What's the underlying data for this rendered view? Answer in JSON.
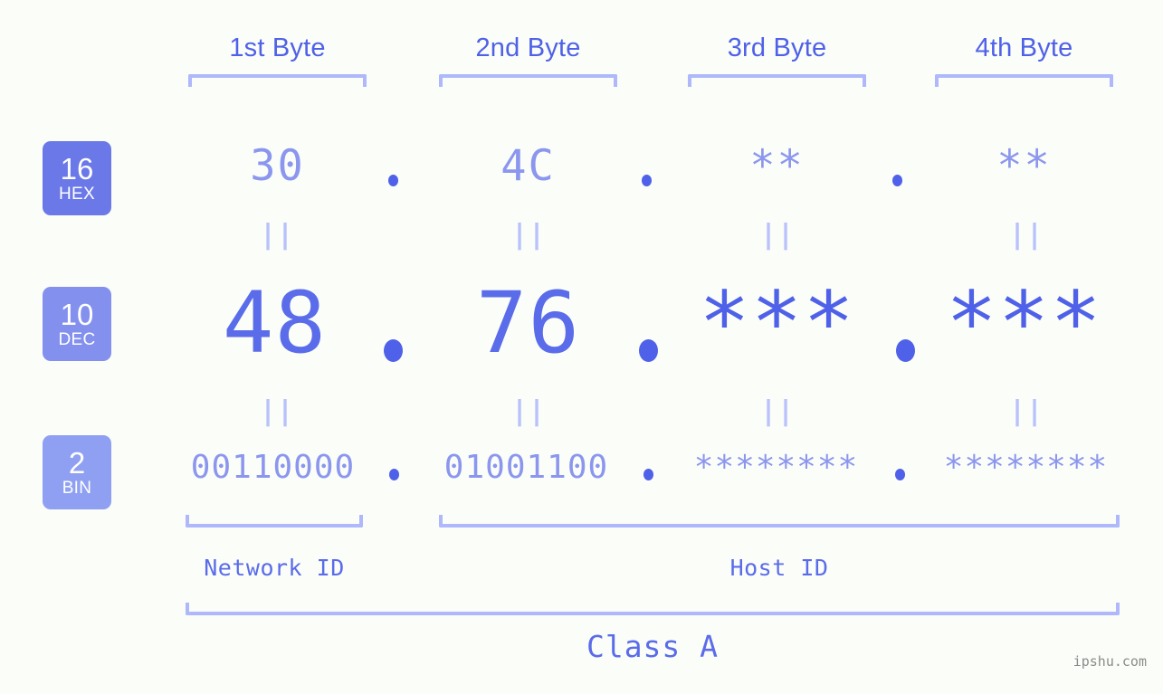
{
  "page": {
    "background_color": "#fbfdf8",
    "accent_color": "#4f61e8",
    "accent_light_color": "#8b96ee",
    "bracket_color": "#aeb8fb"
  },
  "headers": [
    {
      "label": "1st Byte"
    },
    {
      "label": "2nd Byte"
    },
    {
      "label": "3rd Byte"
    },
    {
      "label": "4th Byte"
    }
  ],
  "bases": [
    {
      "number": "16",
      "name": "HEX",
      "color": "#6b78e8"
    },
    {
      "number": "10",
      "name": "DEC",
      "color": "#8490ee"
    },
    {
      "number": "2",
      "name": "BIN",
      "color": "#8fa0f2"
    }
  ],
  "rows": {
    "hex": {
      "base": "16",
      "base_name": "HEX",
      "values": [
        "30",
        "4C",
        "**",
        "**"
      ],
      "separator": "."
    },
    "dec": {
      "base": "10",
      "base_name": "DEC",
      "values": [
        "48",
        "76",
        "***",
        "***"
      ],
      "separator": "."
    },
    "bin": {
      "base": "2",
      "base_name": "BIN",
      "values": [
        "00110000",
        "01001100",
        "********",
        "********"
      ],
      "separator": "."
    }
  },
  "equals": {
    "glyph": "||"
  },
  "segments": {
    "network_id_label": "Network ID",
    "host_id_label": "Host ID"
  },
  "class": {
    "label": "Class A"
  },
  "watermark": {
    "text": "ipshu.com"
  }
}
